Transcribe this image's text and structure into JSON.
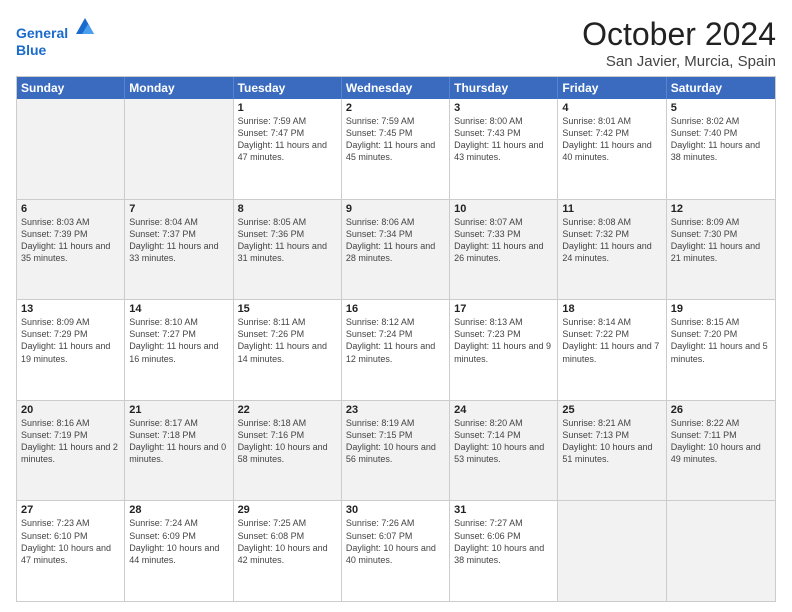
{
  "header": {
    "logo_line1": "General",
    "logo_line2": "Blue",
    "month_title": "October 2024",
    "location": "San Javier, Murcia, Spain"
  },
  "weekdays": [
    "Sunday",
    "Monday",
    "Tuesday",
    "Wednesday",
    "Thursday",
    "Friday",
    "Saturday"
  ],
  "rows": [
    [
      {
        "day": "",
        "info": ""
      },
      {
        "day": "",
        "info": ""
      },
      {
        "day": "1",
        "info": "Sunrise: 7:59 AM\nSunset: 7:47 PM\nDaylight: 11 hours and 47 minutes."
      },
      {
        "day": "2",
        "info": "Sunrise: 7:59 AM\nSunset: 7:45 PM\nDaylight: 11 hours and 45 minutes."
      },
      {
        "day": "3",
        "info": "Sunrise: 8:00 AM\nSunset: 7:43 PM\nDaylight: 11 hours and 43 minutes."
      },
      {
        "day": "4",
        "info": "Sunrise: 8:01 AM\nSunset: 7:42 PM\nDaylight: 11 hours and 40 minutes."
      },
      {
        "day": "5",
        "info": "Sunrise: 8:02 AM\nSunset: 7:40 PM\nDaylight: 11 hours and 38 minutes."
      }
    ],
    [
      {
        "day": "6",
        "info": "Sunrise: 8:03 AM\nSunset: 7:39 PM\nDaylight: 11 hours and 35 minutes."
      },
      {
        "day": "7",
        "info": "Sunrise: 8:04 AM\nSunset: 7:37 PM\nDaylight: 11 hours and 33 minutes."
      },
      {
        "day": "8",
        "info": "Sunrise: 8:05 AM\nSunset: 7:36 PM\nDaylight: 11 hours and 31 minutes."
      },
      {
        "day": "9",
        "info": "Sunrise: 8:06 AM\nSunset: 7:34 PM\nDaylight: 11 hours and 28 minutes."
      },
      {
        "day": "10",
        "info": "Sunrise: 8:07 AM\nSunset: 7:33 PM\nDaylight: 11 hours and 26 minutes."
      },
      {
        "day": "11",
        "info": "Sunrise: 8:08 AM\nSunset: 7:32 PM\nDaylight: 11 hours and 24 minutes."
      },
      {
        "day": "12",
        "info": "Sunrise: 8:09 AM\nSunset: 7:30 PM\nDaylight: 11 hours and 21 minutes."
      }
    ],
    [
      {
        "day": "13",
        "info": "Sunrise: 8:09 AM\nSunset: 7:29 PM\nDaylight: 11 hours and 19 minutes."
      },
      {
        "day": "14",
        "info": "Sunrise: 8:10 AM\nSunset: 7:27 PM\nDaylight: 11 hours and 16 minutes."
      },
      {
        "day": "15",
        "info": "Sunrise: 8:11 AM\nSunset: 7:26 PM\nDaylight: 11 hours and 14 minutes."
      },
      {
        "day": "16",
        "info": "Sunrise: 8:12 AM\nSunset: 7:24 PM\nDaylight: 11 hours and 12 minutes."
      },
      {
        "day": "17",
        "info": "Sunrise: 8:13 AM\nSunset: 7:23 PM\nDaylight: 11 hours and 9 minutes."
      },
      {
        "day": "18",
        "info": "Sunrise: 8:14 AM\nSunset: 7:22 PM\nDaylight: 11 hours and 7 minutes."
      },
      {
        "day": "19",
        "info": "Sunrise: 8:15 AM\nSunset: 7:20 PM\nDaylight: 11 hours and 5 minutes."
      }
    ],
    [
      {
        "day": "20",
        "info": "Sunrise: 8:16 AM\nSunset: 7:19 PM\nDaylight: 11 hours and 2 minutes."
      },
      {
        "day": "21",
        "info": "Sunrise: 8:17 AM\nSunset: 7:18 PM\nDaylight: 11 hours and 0 minutes."
      },
      {
        "day": "22",
        "info": "Sunrise: 8:18 AM\nSunset: 7:16 PM\nDaylight: 10 hours and 58 minutes."
      },
      {
        "day": "23",
        "info": "Sunrise: 8:19 AM\nSunset: 7:15 PM\nDaylight: 10 hours and 56 minutes."
      },
      {
        "day": "24",
        "info": "Sunrise: 8:20 AM\nSunset: 7:14 PM\nDaylight: 10 hours and 53 minutes."
      },
      {
        "day": "25",
        "info": "Sunrise: 8:21 AM\nSunset: 7:13 PM\nDaylight: 10 hours and 51 minutes."
      },
      {
        "day": "26",
        "info": "Sunrise: 8:22 AM\nSunset: 7:11 PM\nDaylight: 10 hours and 49 minutes."
      }
    ],
    [
      {
        "day": "27",
        "info": "Sunrise: 7:23 AM\nSunset: 6:10 PM\nDaylight: 10 hours and 47 minutes."
      },
      {
        "day": "28",
        "info": "Sunrise: 7:24 AM\nSunset: 6:09 PM\nDaylight: 10 hours and 44 minutes."
      },
      {
        "day": "29",
        "info": "Sunrise: 7:25 AM\nSunset: 6:08 PM\nDaylight: 10 hours and 42 minutes."
      },
      {
        "day": "30",
        "info": "Sunrise: 7:26 AM\nSunset: 6:07 PM\nDaylight: 10 hours and 40 minutes."
      },
      {
        "day": "31",
        "info": "Sunrise: 7:27 AM\nSunset: 6:06 PM\nDaylight: 10 hours and 38 minutes."
      },
      {
        "day": "",
        "info": ""
      },
      {
        "day": "",
        "info": ""
      }
    ]
  ]
}
